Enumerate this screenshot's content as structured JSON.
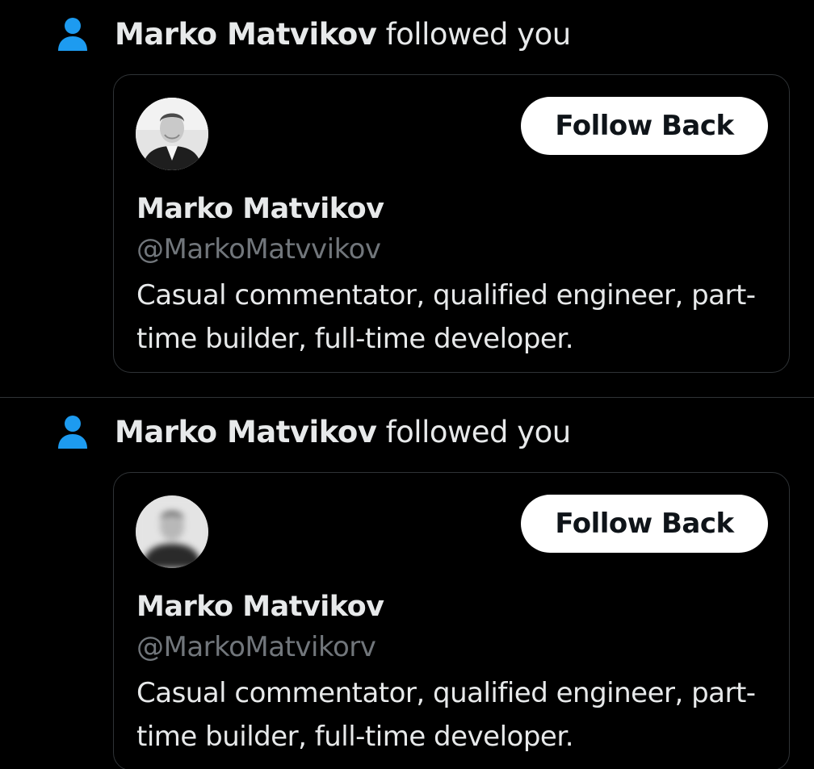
{
  "colors": {
    "background": "#000000",
    "text_primary": "#e7e9ea",
    "text_secondary": "#71767b",
    "accent_icon": "#1d9bf0",
    "button_bg": "#ffffff",
    "button_text": "#0f1419",
    "divider": "#2f3336"
  },
  "notifications": [
    {
      "icon": "person-icon",
      "actor": "Marko Matvikov",
      "action": " followed you",
      "card": {
        "avatar": "profile-photo",
        "follow_label": "Follow Back",
        "name": "Marko Matvikov",
        "handle": "@MarkoMatvvikov",
        "bio": "Casual commentator, qualified engineer, part-time builder, full-time developer."
      }
    },
    {
      "icon": "person-icon",
      "actor": "Marko Matvikov",
      "action": " followed you",
      "card": {
        "avatar": "profile-photo-blurred",
        "follow_label": "Follow Back",
        "name": "Marko Matvikov",
        "handle": "@MarkoMatvikorv",
        "bio": "Casual commentator, qualified engineer, part-time builder, full-time developer."
      }
    }
  ]
}
